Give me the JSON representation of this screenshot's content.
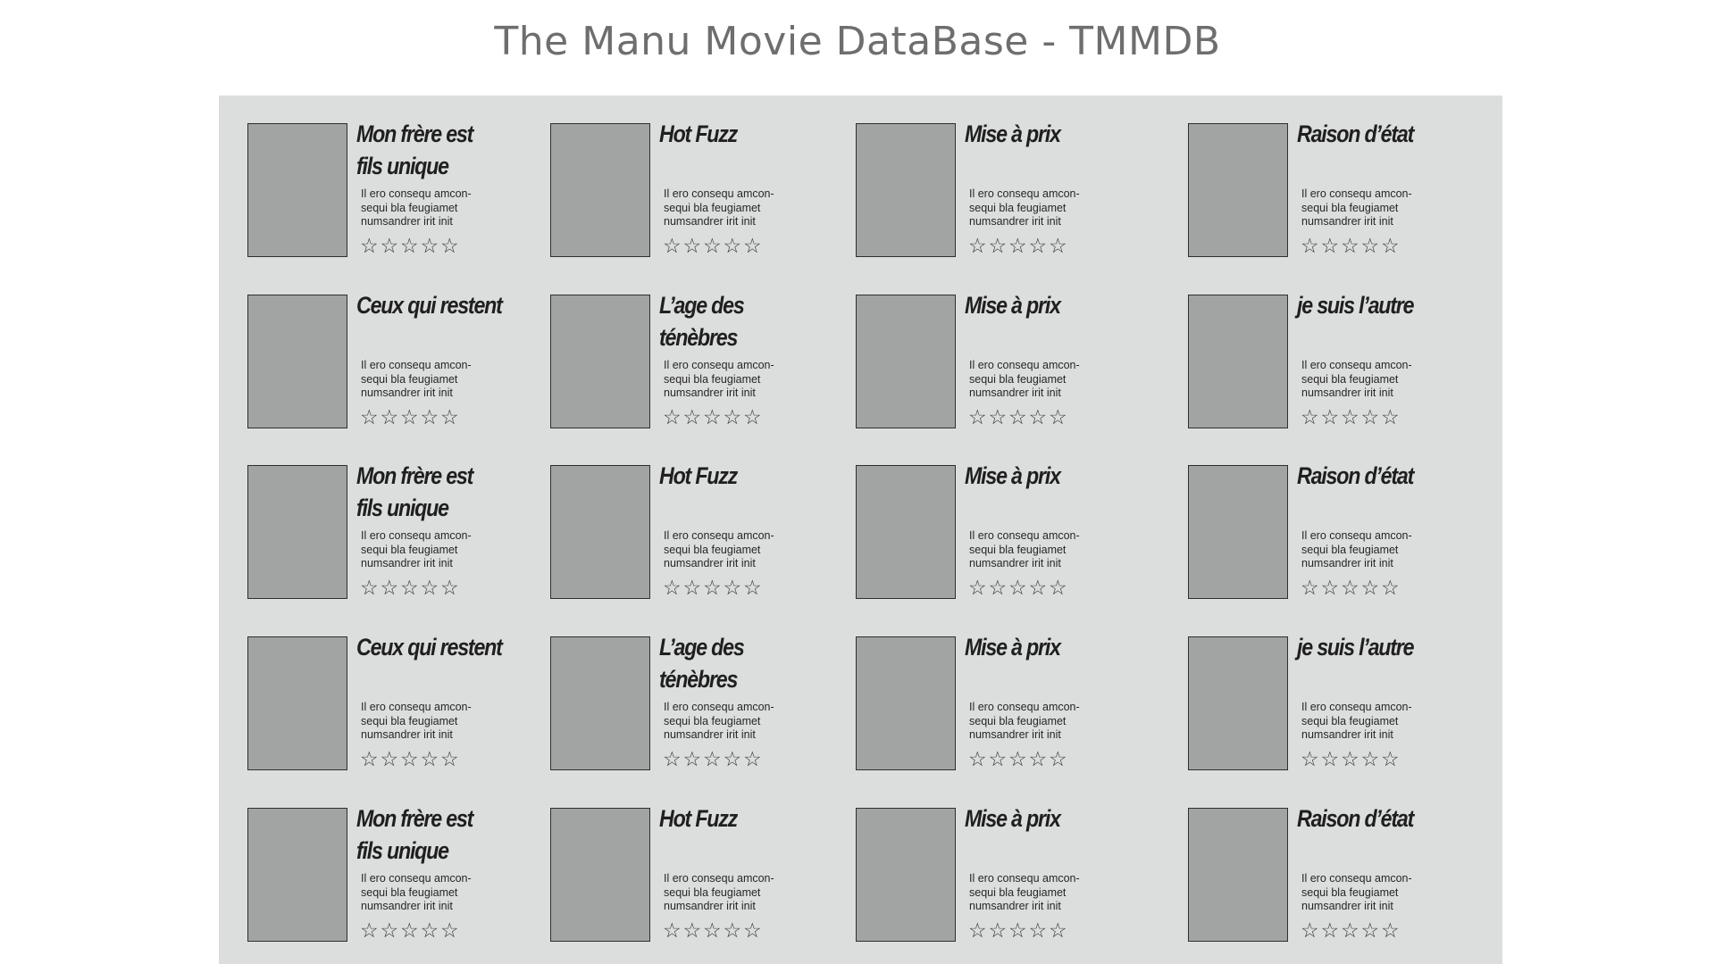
{
  "header": {
    "title": "The Manu Movie DataBase - TMMDB"
  },
  "movies": [
    {
      "title": "Mon frère est fils unique",
      "desc": "Il ero consequ amcon-sequi bla feugiamet numsandrer irit init",
      "rating": 0,
      "max_rating": 5
    },
    {
      "title": "Hot Fuzz",
      "desc": "Il ero consequ amcon-sequi bla feugiamet numsandrer irit init",
      "rating": 0,
      "max_rating": 5
    },
    {
      "title": "Mise à prix",
      "desc": "Il ero consequ amcon-sequi bla feugiamet numsandrer irit init",
      "rating": 0,
      "max_rating": 5
    },
    {
      "title": "Raison d’état",
      "desc": "Il ero consequ amcon-sequi bla feugiamet numsandrer irit init",
      "rating": 0,
      "max_rating": 5
    },
    {
      "title": "Ceux qui restent",
      "desc": "Il ero consequ amcon-sequi bla feugiamet numsandrer irit init",
      "rating": 0,
      "max_rating": 5
    },
    {
      "title": "L’age des ténèbres",
      "desc": "Il ero consequ amcon-sequi bla feugiamet numsandrer irit init",
      "rating": 0,
      "max_rating": 5
    },
    {
      "title": "Mise à prix",
      "desc": "Il ero consequ amcon-sequi bla feugiamet numsandrer irit init",
      "rating": 0,
      "max_rating": 5
    },
    {
      "title": "je suis l’autre",
      "desc": "Il ero consequ amcon-sequi bla feugiamet numsandrer irit init",
      "rating": 0,
      "max_rating": 5
    },
    {
      "title": "Mon frère est fils unique",
      "desc": "Il ero consequ amcon-sequi bla feugiamet numsandrer irit init",
      "rating": 0,
      "max_rating": 5
    },
    {
      "title": "Hot Fuzz",
      "desc": "Il ero consequ amcon-sequi bla feugiamet numsandrer irit init",
      "rating": 0,
      "max_rating": 5
    },
    {
      "title": "Mise à prix",
      "desc": "Il ero consequ amcon-sequi bla feugiamet numsandrer irit init",
      "rating": 0,
      "max_rating": 5
    },
    {
      "title": "Raison d’état",
      "desc": "Il ero consequ amcon-sequi bla feugiamet numsandrer irit init",
      "rating": 0,
      "max_rating": 5
    },
    {
      "title": "Ceux qui restent",
      "desc": "Il ero consequ amcon-sequi bla feugiamet numsandrer irit init",
      "rating": 0,
      "max_rating": 5
    },
    {
      "title": "L’age des ténèbres",
      "desc": "Il ero consequ amcon-sequi bla feugiamet numsandrer irit init",
      "rating": 0,
      "max_rating": 5
    },
    {
      "title": "Mise à prix",
      "desc": "Il ero consequ amcon-sequi bla feugiamet numsandrer irit init",
      "rating": 0,
      "max_rating": 5
    },
    {
      "title": "je suis l’autre",
      "desc": "Il ero consequ amcon-sequi bla feugiamet numsandrer irit init",
      "rating": 0,
      "max_rating": 5
    },
    {
      "title": "Mon frère est fils unique",
      "desc": "Il ero consequ amcon-sequi bla feugiamet numsandrer irit init",
      "rating": 0,
      "max_rating": 5
    },
    {
      "title": "Hot Fuzz",
      "desc": "Il ero consequ amcon-sequi bla feugiamet numsandrer irit init",
      "rating": 0,
      "max_rating": 5
    },
    {
      "title": "Mise à prix",
      "desc": "Il ero consequ amcon-sequi bla feugiamet numsandrer irit init",
      "rating": 0,
      "max_rating": 5
    },
    {
      "title": "Raison d’état",
      "desc": "Il ero consequ amcon-sequi bla feugiamet numsandrer irit init",
      "rating": 0,
      "max_rating": 5
    }
  ],
  "icons": {
    "star": "star-outline-icon"
  }
}
